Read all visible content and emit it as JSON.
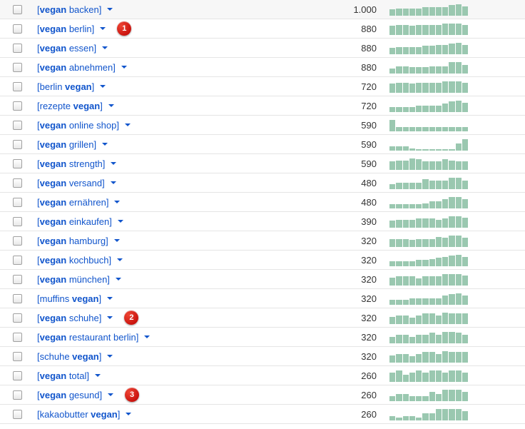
{
  "rows": [
    {
      "prefix": "vegan",
      "suffix": " backen",
      "order": "bs",
      "volume": "1.000",
      "trend": [
        6,
        7,
        7,
        7,
        7,
        8,
        8,
        8,
        8,
        10,
        11,
        9
      ],
      "badge": null
    },
    {
      "prefix": "vegan",
      "suffix": " berlin",
      "order": "bs",
      "volume": "880",
      "trend": [
        8,
        9,
        9,
        8,
        9,
        9,
        9,
        9,
        10,
        10,
        10,
        9
      ],
      "badge": "1"
    },
    {
      "prefix": "vegan",
      "suffix": " essen",
      "order": "bs",
      "volume": "880",
      "trend": [
        6,
        7,
        7,
        7,
        7,
        8,
        8,
        9,
        9,
        10,
        11,
        9
      ],
      "badge": null
    },
    {
      "prefix": "vegan",
      "suffix": " abnehmen",
      "order": "bs",
      "volume": "880",
      "trend": [
        5,
        7,
        7,
        6,
        6,
        6,
        7,
        7,
        7,
        11,
        11,
        8
      ],
      "badge": null
    },
    {
      "prefix": "berlin ",
      "suffix": "vegan",
      "order": "sb",
      "volume": "720",
      "trend": [
        8,
        9,
        9,
        8,
        9,
        9,
        9,
        9,
        10,
        10,
        10,
        9
      ],
      "badge": null
    },
    {
      "prefix": "rezepte ",
      "suffix": "vegan",
      "order": "sb",
      "volume": "720",
      "trend": [
        5,
        5,
        5,
        5,
        6,
        6,
        6,
        6,
        8,
        10,
        11,
        9
      ],
      "badge": null
    },
    {
      "prefix": "vegan",
      "suffix": " online shop",
      "order": "bs",
      "volume": "590",
      "trend": [
        8,
        3,
        3,
        3,
        3,
        3,
        3,
        3,
        3,
        3,
        3,
        3
      ],
      "badge": null
    },
    {
      "prefix": "vegan",
      "suffix": " grillen",
      "order": "bs",
      "volume": "590",
      "trend": [
        4,
        4,
        4,
        2,
        1,
        1,
        1,
        1,
        1,
        1,
        7,
        11
      ],
      "badge": null
    },
    {
      "prefix": "vegan",
      "suffix": " strength",
      "order": "bs",
      "volume": "590",
      "trend": [
        8,
        9,
        9,
        11,
        10,
        8,
        8,
        8,
        10,
        9,
        8,
        8
      ],
      "badge": null
    },
    {
      "prefix": "vegan",
      "suffix": " versand",
      "order": "bs",
      "volume": "480",
      "trend": [
        4,
        5,
        5,
        5,
        5,
        8,
        7,
        7,
        7,
        9,
        9,
        7
      ],
      "badge": null
    },
    {
      "prefix": "vegan",
      "suffix": " ernähren",
      "order": "bs",
      "volume": "480",
      "trend": [
        4,
        4,
        4,
        4,
        4,
        5,
        7,
        7,
        9,
        11,
        11,
        9
      ],
      "badge": null
    },
    {
      "prefix": "vegan",
      "suffix": " einkaufen",
      "order": "bs",
      "volume": "390",
      "trend": [
        6,
        7,
        7,
        7,
        8,
        8,
        8,
        7,
        8,
        10,
        10,
        9
      ],
      "badge": null
    },
    {
      "prefix": "vegan",
      "suffix": " hamburg",
      "order": "bs",
      "volume": "320",
      "trend": [
        7,
        7,
        7,
        6,
        7,
        7,
        7,
        9,
        8,
        10,
        10,
        8
      ],
      "badge": null
    },
    {
      "prefix": "vegan",
      "suffix": " kochbuch",
      "order": "bs",
      "volume": "320",
      "trend": [
        5,
        5,
        5,
        5,
        6,
        6,
        7,
        8,
        9,
        10,
        11,
        9
      ],
      "badge": null
    },
    {
      "prefix": "vegan",
      "suffix": " münchen",
      "order": "bs",
      "volume": "320",
      "trend": [
        7,
        8,
        8,
        8,
        6,
        8,
        8,
        8,
        10,
        10,
        10,
        9
      ],
      "badge": null
    },
    {
      "prefix": "muffins ",
      "suffix": "vegan",
      "order": "sb",
      "volume": "320",
      "trend": [
        5,
        5,
        5,
        6,
        6,
        6,
        6,
        6,
        9,
        10,
        11,
        9
      ],
      "badge": null
    },
    {
      "prefix": "vegan",
      "suffix": " schuhe",
      "order": "bs",
      "volume": "320",
      "trend": [
        7,
        8,
        8,
        6,
        8,
        10,
        10,
        8,
        11,
        10,
        10,
        10
      ],
      "badge": "2"
    },
    {
      "prefix": "vegan",
      "suffix": " restaurant berlin",
      "order": "bs",
      "volume": "320",
      "trend": [
        6,
        8,
        8,
        6,
        8,
        8,
        10,
        8,
        11,
        11,
        10,
        8
      ],
      "badge": null
    },
    {
      "prefix": "schuhe ",
      "suffix": "vegan",
      "order": "sb",
      "volume": "320",
      "trend": [
        7,
        8,
        8,
        6,
        8,
        10,
        10,
        8,
        11,
        10,
        10,
        10
      ],
      "badge": null
    },
    {
      "prefix": "vegan",
      "suffix": " total",
      "order": "bs",
      "volume": "260",
      "trend": [
        8,
        10,
        6,
        8,
        10,
        8,
        10,
        10,
        8,
        10,
        10,
        8
      ],
      "badge": null
    },
    {
      "prefix": "vegan",
      "suffix": " gesund",
      "order": "bs",
      "volume": "260",
      "trend": [
        5,
        7,
        7,
        5,
        5,
        5,
        9,
        7,
        11,
        11,
        11,
        9
      ],
      "badge": "3"
    },
    {
      "prefix": "kakaobutter ",
      "suffix": "vegan",
      "order": "sb",
      "volume": "260",
      "trend": [
        4,
        3,
        4,
        4,
        3,
        7,
        7,
        11,
        11,
        11,
        11,
        9
      ],
      "badge": null
    }
  ]
}
